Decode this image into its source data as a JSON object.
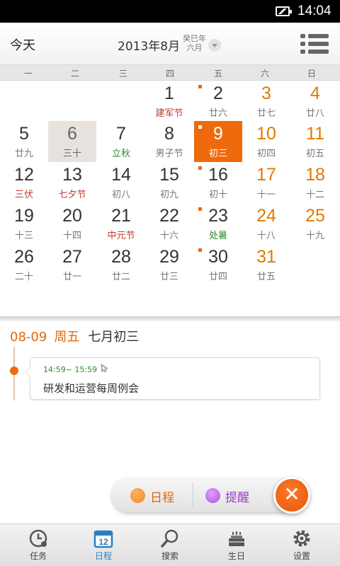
{
  "status_bar": {
    "time": "14:04"
  },
  "header": {
    "today_label": "今天",
    "year_month": "2013年8月",
    "lunar_year": "癸巳年",
    "lunar_month": "六月"
  },
  "weekdays": [
    "一",
    "二",
    "三",
    "四",
    "五",
    "六",
    "日"
  ],
  "calendar": {
    "days": [
      {
        "num": "1",
        "sub": "建军节",
        "sub_style": "red"
      },
      {
        "num": "2",
        "sub": "廿六",
        "mark": true
      },
      {
        "num": "3",
        "sub": "廿七"
      },
      {
        "num": "4",
        "sub": "廿八"
      },
      {
        "num": "5",
        "sub": "廿九"
      },
      {
        "num": "6",
        "sub": "三十",
        "state": "past"
      },
      {
        "num": "7",
        "sub": "立秋",
        "sub_style": "green"
      },
      {
        "num": "8",
        "sub": "男子节"
      },
      {
        "num": "9",
        "sub": "初三",
        "state": "selected",
        "mark": true
      },
      {
        "num": "10",
        "sub": "初四"
      },
      {
        "num": "11",
        "sub": "初五"
      },
      {
        "num": "12",
        "sub": "三伏",
        "sub_style": "red"
      },
      {
        "num": "13",
        "sub": "七夕节",
        "sub_style": "red"
      },
      {
        "num": "14",
        "sub": "初八"
      },
      {
        "num": "15",
        "sub": "初九"
      },
      {
        "num": "16",
        "sub": "初十",
        "mark": true
      },
      {
        "num": "17",
        "sub": "十一"
      },
      {
        "num": "18",
        "sub": "十二"
      },
      {
        "num": "19",
        "sub": "十三"
      },
      {
        "num": "20",
        "sub": "十四"
      },
      {
        "num": "21",
        "sub": "中元节",
        "sub_style": "red"
      },
      {
        "num": "22",
        "sub": "十六"
      },
      {
        "num": "23",
        "sub": "处暑",
        "sub_style": "green",
        "mark": true
      },
      {
        "num": "24",
        "sub": "十八"
      },
      {
        "num": "25",
        "sub": "十九"
      },
      {
        "num": "26",
        "sub": "二十"
      },
      {
        "num": "27",
        "sub": "廿一"
      },
      {
        "num": "28",
        "sub": "廿二"
      },
      {
        "num": "29",
        "sub": "廿三"
      },
      {
        "num": "30",
        "sub": "廿四",
        "mark": true
      },
      {
        "num": "31",
        "sub": "廿五"
      }
    ]
  },
  "day_detail": {
    "date": "08-09",
    "weekday": "周五",
    "lunar": "七月初三",
    "events": [
      {
        "time": "14:59~ 15:59",
        "title": "研发和运营每周例会"
      }
    ]
  },
  "fab_menu": {
    "schedule_label": "日程",
    "schedule_color": "#f08a2c",
    "reminder_label": "提醒",
    "reminder_color": "#b04fd8"
  },
  "bottom_nav": [
    {
      "label": "任务",
      "icon": "clock-icon"
    },
    {
      "label": "日程",
      "icon": "calendar-icon"
    },
    {
      "label": "搜索",
      "icon": "search-icon"
    },
    {
      "label": "生日",
      "icon": "cake-icon"
    },
    {
      "label": "设置",
      "icon": "gear-icon"
    }
  ],
  "colors": {
    "accent": "#ee6a0c",
    "weekend": "#e07a00",
    "festival": "#c0392b",
    "solar_term": "#2e8b2e",
    "nav_active": "#2a7fc2"
  }
}
